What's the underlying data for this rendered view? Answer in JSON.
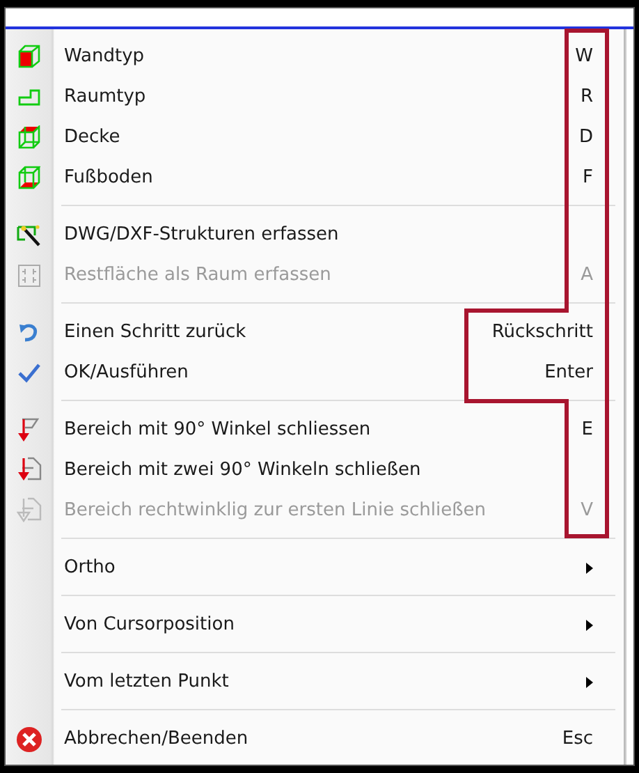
{
  "menu": {
    "items": [
      {
        "kind": "item",
        "label": "Wandtyp",
        "shortcut": "W",
        "disabled": false
      },
      {
        "kind": "item",
        "label": "Raumtyp",
        "shortcut": "R",
        "disabled": false
      },
      {
        "kind": "item",
        "label": "Decke",
        "shortcut": "D",
        "disabled": false
      },
      {
        "kind": "item",
        "label": "Fußboden",
        "shortcut": "F",
        "disabled": false
      },
      {
        "kind": "separator"
      },
      {
        "kind": "item",
        "label": "DWG/DXF-Strukturen erfassen",
        "disabled": false
      },
      {
        "kind": "item",
        "label": "Restfläche als Raum erfassen",
        "shortcut": "A",
        "disabled": true
      },
      {
        "kind": "separator"
      },
      {
        "kind": "item",
        "label": "Einen Schritt zurück",
        "shortcut": "Rückschritt",
        "disabled": false
      },
      {
        "kind": "item",
        "label": "OK/Ausführen",
        "shortcut": "Enter",
        "disabled": false
      },
      {
        "kind": "separator"
      },
      {
        "kind": "item",
        "label": "Bereich mit 90° Winkel schliessen",
        "shortcut": "E",
        "disabled": false
      },
      {
        "kind": "item",
        "label": "Bereich mit zwei 90° Winkeln schließen",
        "disabled": false
      },
      {
        "kind": "item",
        "label": "Bereich rechtwinklig zur ersten Linie schließen",
        "shortcut": "V",
        "disabled": true
      },
      {
        "kind": "separator"
      },
      {
        "kind": "submenu",
        "label": "Ortho",
        "disabled": false
      },
      {
        "kind": "separator"
      },
      {
        "kind": "submenu",
        "label": "Von Cursorposition",
        "disabled": false
      },
      {
        "kind": "separator"
      },
      {
        "kind": "submenu",
        "label": "Vom letzten Punkt",
        "disabled": false
      },
      {
        "kind": "separator"
      },
      {
        "kind": "item",
        "label": "Abbrechen/Beenden",
        "shortcut": "Esc",
        "disabled": false
      }
    ]
  }
}
